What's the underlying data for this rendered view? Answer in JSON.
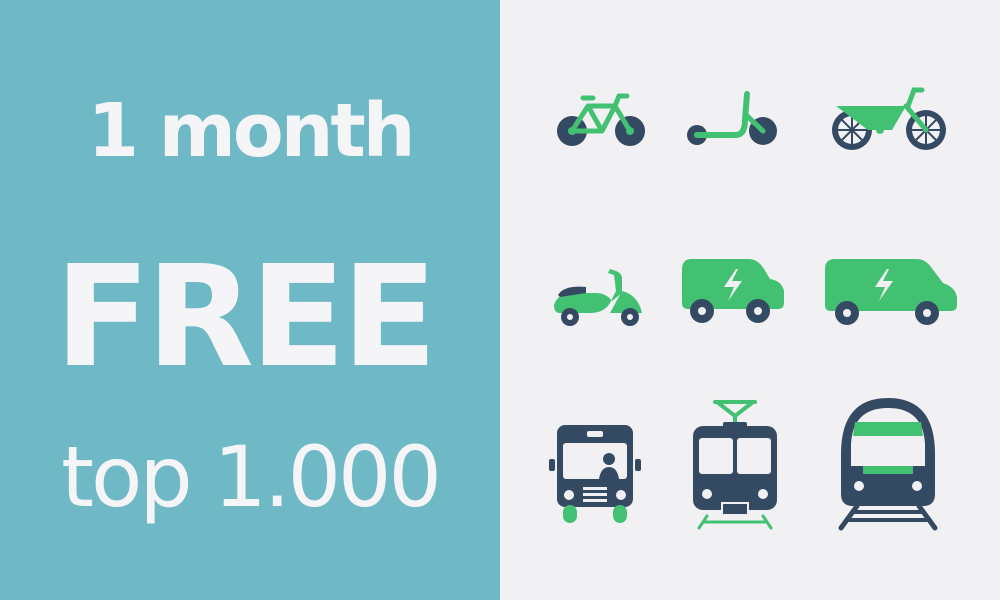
{
  "promo": {
    "line1": "1 month",
    "line2": "FREE",
    "line3": "top 1.000"
  },
  "colors": {
    "left_bg": "#6fb9c6",
    "right_bg": "#f1f1f3",
    "green": "#43c173",
    "navy": "#344a63",
    "white": "#f5f5f8"
  },
  "icons": [
    "bicycle-icon",
    "kick-scooter-icon",
    "cargo-bike-icon",
    "moped-icon",
    "electric-car-icon",
    "electric-van-icon",
    "bus-icon",
    "tram-icon",
    "train-icon"
  ]
}
